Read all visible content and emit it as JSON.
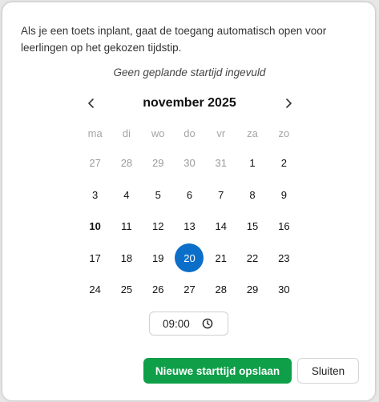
{
  "dialog": {
    "intro_text": "Als je een toets inplant, gaat de toegang automatisch open voor leerlingen op het gekozen tijdstip.",
    "empty_note": "Geen geplande startijd ingevuld"
  },
  "calendar": {
    "month_label": "november 2025",
    "prev_icon": "chevron-left-icon",
    "next_icon": "chevron-right-icon",
    "weekdays": [
      "ma",
      "di",
      "wo",
      "do",
      "vr",
      "za",
      "zo"
    ],
    "weeks": [
      [
        "27",
        "28",
        "29",
        "30",
        "31",
        "1",
        "2"
      ],
      [
        "3",
        "4",
        "5",
        "6",
        "7",
        "8",
        "9"
      ],
      [
        "10",
        "11",
        "12",
        "13",
        "14",
        "15",
        "16"
      ],
      [
        "17",
        "18",
        "19",
        "20",
        "21",
        "22",
        "23"
      ],
      [
        "24",
        "25",
        "26",
        "27",
        "28",
        "29",
        "30"
      ]
    ],
    "outside_month_days_first_week": 5,
    "today": "10",
    "selected": "20",
    "selected_color": "#0b6fc9"
  },
  "time": {
    "value": "09:00",
    "icon": "clock-icon"
  },
  "actions": {
    "save_label": "Nieuwe starttijd opslaan",
    "save_color": "#0f9f49",
    "close_label": "Sluiten"
  }
}
